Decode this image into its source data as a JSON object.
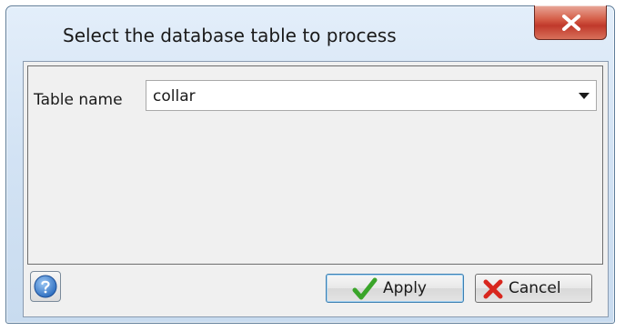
{
  "dialog": {
    "title": "Select the database table to process"
  },
  "form": {
    "table_name_label": "Table name",
    "table_name_value": "collar"
  },
  "buttons": {
    "apply_label": "Apply",
    "cancel_label": "Cancel"
  },
  "icons": {
    "close": "close-icon",
    "dropdown": "chevron-down-icon",
    "help": "help-icon",
    "apply": "checkmark-icon",
    "cancel": "x-icon"
  },
  "colors": {
    "close_button": "#c0392b",
    "help_icon": "#2f6fc0",
    "apply_check": "#3aa52a",
    "cancel_x": "#d8271e"
  }
}
